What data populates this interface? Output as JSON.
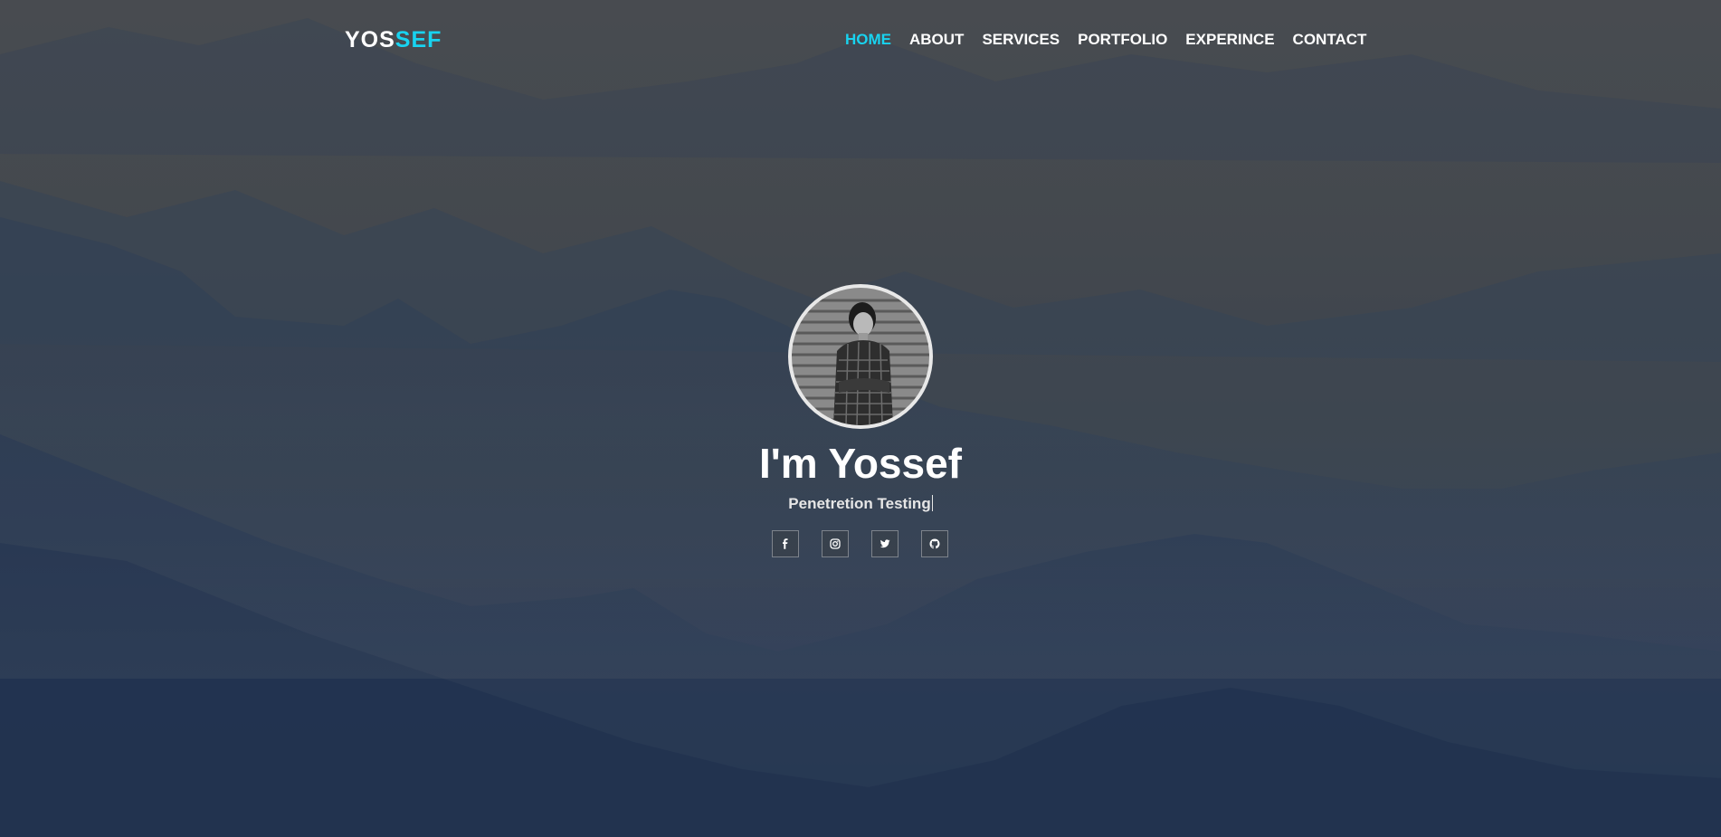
{
  "brand": {
    "logo_part1": "YOS",
    "logo_part2": "SEF",
    "accent_color": "#18d3f0"
  },
  "nav": {
    "items": [
      {
        "label": "HOME",
        "active": true
      },
      {
        "label": "ABOUT",
        "active": false
      },
      {
        "label": "SERVICES",
        "active": false
      },
      {
        "label": "PORTFOLIO",
        "active": false
      },
      {
        "label": "EXPERINCE",
        "active": false
      },
      {
        "label": "CONTACT",
        "active": false
      }
    ]
  },
  "hero": {
    "title": "I'm Yossef",
    "subtitle": "Penetretion Testing"
  },
  "social": [
    {
      "icon": "facebook-icon"
    },
    {
      "icon": "instagram-icon"
    },
    {
      "icon": "twitter-icon"
    },
    {
      "icon": "github-icon"
    }
  ]
}
